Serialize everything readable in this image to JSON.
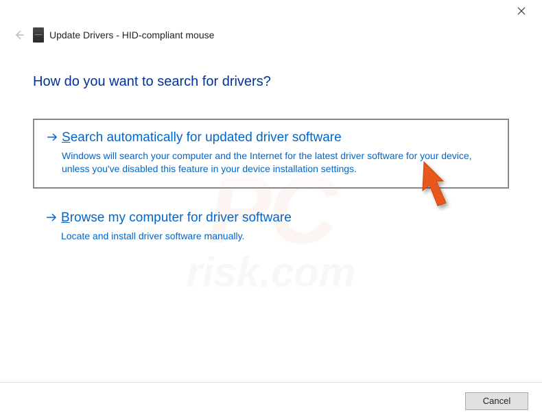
{
  "header": {
    "title": "Update Drivers - HID-compliant mouse"
  },
  "question": "How do you want to search for drivers?",
  "options": {
    "auto": {
      "mnemonic": "S",
      "title_rest": "earch automatically for updated driver software",
      "desc": "Windows will search your computer and the Internet for the latest driver software for your device, unless you've disabled this feature in your device installation settings."
    },
    "browse": {
      "mnemonic": "B",
      "title_rest": "rowse my computer for driver software",
      "desc": "Locate and install driver software manually."
    }
  },
  "footer": {
    "cancel": "Cancel"
  },
  "watermark": {
    "main": "PC",
    "sub": "risk.com"
  }
}
